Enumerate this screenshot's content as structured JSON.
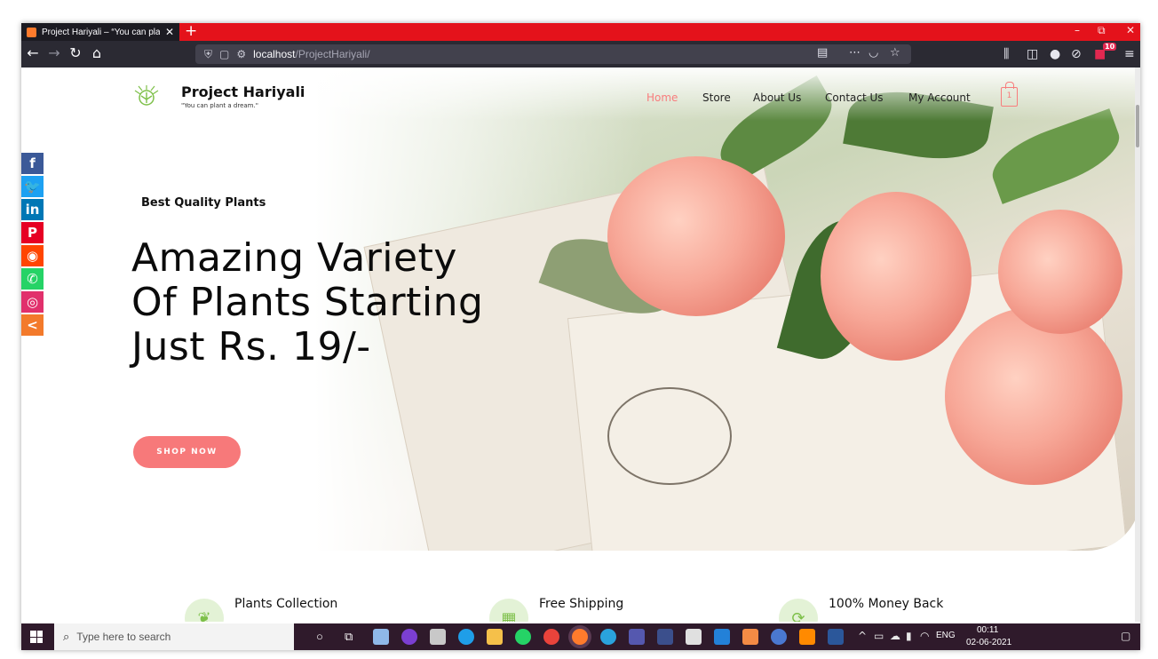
{
  "browser": {
    "tab_title": "Project Hariyali – “You can plan",
    "tab_close": "✕",
    "new_tab": "+",
    "window_controls": {
      "minimize": "–",
      "restore": "⧉",
      "close": "✕"
    },
    "url_host": "localhost",
    "url_path": "/ProjectHariyali/",
    "badge_count": "10"
  },
  "site": {
    "brand": "Project Hariyali",
    "tagline": "\"You can plant a dream.\"",
    "nav": [
      {
        "label": "Home"
      },
      {
        "label": "Store"
      },
      {
        "label": "About Us"
      },
      {
        "label": "Contact Us"
      },
      {
        "label": "My Account"
      }
    ],
    "cart_count": "1"
  },
  "hero": {
    "eyebrow": "Best Quality Plants",
    "headline_lines": [
      "Amazing Variety",
      "Of Plants Starting",
      "Just Rs. 19/-"
    ],
    "cta": "SHOP NOW"
  },
  "share": [
    {
      "glyph": "f",
      "color": "#3b5998",
      "icon": "facebook-icon"
    },
    {
      "glyph": "🐦",
      "color": "#1da1f2",
      "icon": "twitter-icon"
    },
    {
      "glyph": "in",
      "color": "#0077b5",
      "icon": "linkedin-icon"
    },
    {
      "glyph": "P",
      "color": "#e60023",
      "icon": "pinterest-icon"
    },
    {
      "glyph": "◉",
      "color": "#ff4500",
      "icon": "reddit-icon"
    },
    {
      "glyph": "✆",
      "color": "#25d366",
      "icon": "whatsapp-icon"
    },
    {
      "glyph": "◎",
      "color": "#e1306c",
      "icon": "instagram-icon"
    },
    {
      "glyph": "<",
      "color": "#f37a2b",
      "icon": "share-icon"
    }
  ],
  "features": [
    {
      "title": "Plants Collection",
      "icon": "leaf-icon"
    },
    {
      "title": "Free Shipping",
      "icon": "box-icon"
    },
    {
      "title": "100% Money Back",
      "icon": "refresh-icon"
    }
  ],
  "taskbar": {
    "search_placeholder": "Type here to search",
    "tray_lang": "ENG",
    "time": "00:11",
    "date": "02-06-2021"
  },
  "colors": {
    "accent": "#f7797a",
    "tab_red": "#e4121b",
    "browser_dark": "#2b2a33",
    "taskbar": "#2f1a2b"
  }
}
